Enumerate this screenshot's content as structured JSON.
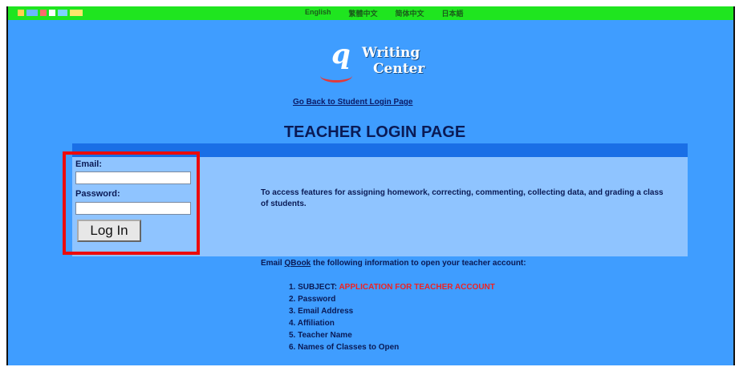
{
  "top_bar": {
    "languages": [
      "English",
      "繁體中文",
      "简体中文",
      "日本語"
    ],
    "decorative_dots": [
      "#ffd24d",
      "#6bb7ff",
      "#ff6b6b",
      "#ffffff",
      "#7dd3ff",
      "#ffe66b"
    ]
  },
  "logo": {
    "letter": "q",
    "line1": "Writing",
    "line2": "Center"
  },
  "nav": {
    "go_back_link": "Go Back to Student Login Page"
  },
  "page": {
    "title": "TEACHER LOGIN PAGE"
  },
  "login_form": {
    "email_label": "Email:",
    "email_value": "",
    "password_label": "Password:",
    "password_value": "",
    "login_button": "Log In"
  },
  "info": {
    "description": "To access features for assigning homework, correcting, commenting, collecting data, and grading a class of students.",
    "email_prefix": "Email ",
    "email_link": "QBook",
    "email_suffix": " the following information to open your teacher account:",
    "steps": [
      {
        "num": "1.",
        "label": "SUBJECT:",
        "value": "APPLICATION FOR TEACHER ACCOUNT"
      },
      {
        "num": "2.",
        "label": "Password",
        "value": ""
      },
      {
        "num": "3.",
        "label": "Email Address",
        "value": ""
      },
      {
        "num": "4.",
        "label": "Affiliation",
        "value": ""
      },
      {
        "num": "5.",
        "label": "Teacher Name",
        "value": ""
      },
      {
        "num": "6.",
        "label": "Names of Classes to Open",
        "value": ""
      }
    ]
  },
  "colors": {
    "background": "#3f9dff",
    "top_bar": "#1fe51f",
    "highlight_box": "#ec0b0b",
    "panel": "#8fc4ff",
    "panel_header": "#1a6fe6",
    "subject_red": "#ee2222"
  }
}
